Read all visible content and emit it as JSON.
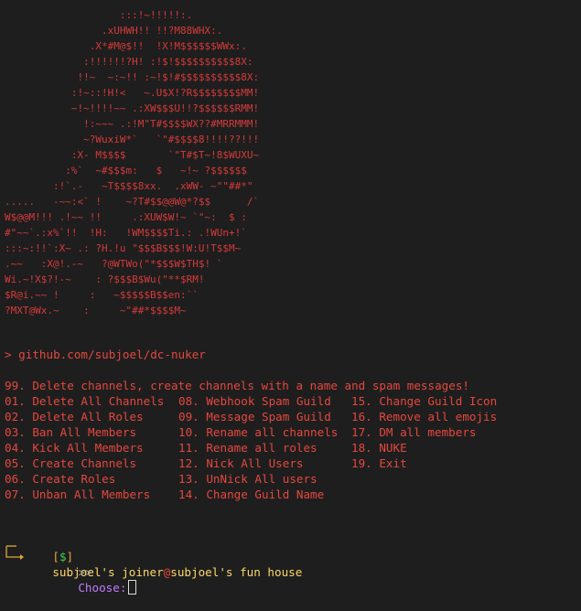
{
  "ascii_art": "                   :::!~!!!!!:.\n                .xUHWH!! !!?M88WHX:.\n              .X*#M@$!!  !X!M$$$$$$WWx:.\n             :!!!!!!?H! :!$!$$$$$$$$$$8X:\n            !!~  ~:~!! :~!$!#$$$$$$$$$$8X:\n           :!~::!H!<   ~.U$X!?R$$$$$$$$MM!\n           ~!~!!!!~~ .:XW$$$U!!?$$$$$$RMM!\n             !:~~~ .:!M\"T#$$$$WX??#MRRMMM!\n             ~?WuxiW*`   `\"#$$$$8!!!!??!!!\n           :X- M$$$$       `\"T#$T~!8$WUXU~\n          :%`  ~#$$$m:   $   ~!~ ?$$$$$$\n        :!`.-   ~T$$$$8xx.  .xWW- ~\"\"##*\"\n.....   -~~:<` !    ~?T#$$@@W@*?$$      /`\nW$@@M!!! .!~~ !!     .:XUW$W!~ `\"~:  $ :\n#\"~~`.:x%`!!  !H:   !WM$$$$Ti.: .!WUn+!`\n:::~:!!`:X~ .: ?H.!u \"$$$B$$$!W:U!T$$M~\n.~~   :X@!.-~   ?@WTWo(\"*$$$W$TH$! `\nWi.~!X$?!-~    : ?$$$B$Wu(\"**$RM!\n$R@i.~~ !     :   ~$$$$$B$$en:``\n?MXT@Wx.~    :     ~\"##*$$$$M~",
  "repo_line": "> github.com/subjoel/dc-nuker",
  "option_99": "99. Delete channels, create channels with a name and spam messages!",
  "menu": {
    "col1": [
      "01. Delete All Channels",
      "02. Delete All Roles",
      "03. Ban All Members",
      "04. Kick All Members",
      "05. Create Channels",
      "06. Create Roles",
      "07. Unban All Members"
    ],
    "col2": [
      "08. Webhook Spam Guild",
      "09. Message Spam Guild",
      "10. Rename all channels",
      "11. Rename all roles",
      "12. Nick All Users",
      "13. UnNick All users",
      "14. Change Guild Name"
    ],
    "col3": [
      "15. Change Guild Icon",
      "16. Remove all emojis",
      "17. DM all members",
      "18. NUKE",
      "19. Exit"
    ]
  },
  "prompt": {
    "bracket_open": "[",
    "dollar": "$",
    "bracket_close": "]",
    "user": "subjoel's joiner",
    "at": "@",
    "host": "subjoel's fun house",
    "arrows": ">>",
    "choose": "Choose:"
  },
  "colors": {
    "background": "#1e1e1e",
    "text_red": "#e5483f",
    "prompt_yellow": "#ffd866",
    "dollar_green": "#3fd15c",
    "tree_orange": "#e0a83a",
    "choose_purple": "#c47bff"
  }
}
